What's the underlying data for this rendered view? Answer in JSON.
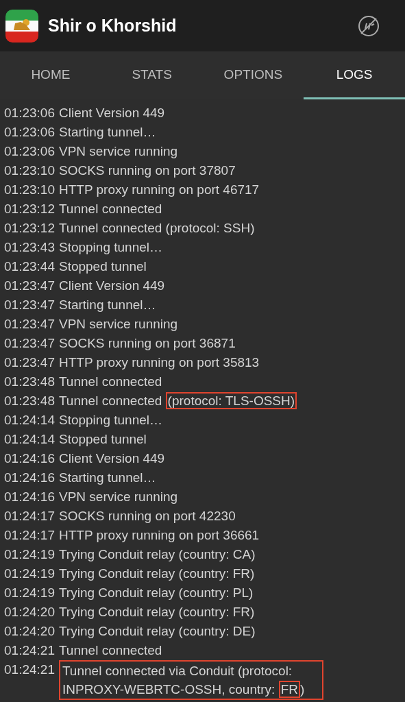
{
  "app_bar": {
    "title": "Shir o Khorshid"
  },
  "tabs": [
    {
      "label": "HOME",
      "selected": false
    },
    {
      "label": "STATS",
      "selected": false
    },
    {
      "label": "OPTIONS",
      "selected": false
    },
    {
      "label": "LOGS",
      "selected": true
    }
  ],
  "logs": [
    {
      "time": "01:23:06",
      "boxed": false,
      "message": [
        {
          "text": "Client Version 449",
          "boxed": false
        }
      ]
    },
    {
      "time": "01:23:06",
      "boxed": false,
      "message": [
        {
          "text": "Starting tunnel…",
          "boxed": false
        }
      ]
    },
    {
      "time": "01:23:06",
      "boxed": false,
      "message": [
        {
          "text": "VPN service running",
          "boxed": false
        }
      ]
    },
    {
      "time": "01:23:10",
      "boxed": false,
      "message": [
        {
          "text": "SOCKS running on port 37807",
          "boxed": false
        }
      ]
    },
    {
      "time": "01:23:10",
      "boxed": false,
      "message": [
        {
          "text": "HTTP proxy running on port 46717",
          "boxed": false
        }
      ]
    },
    {
      "time": "01:23:12",
      "boxed": false,
      "message": [
        {
          "text": "Tunnel connected",
          "boxed": false
        }
      ]
    },
    {
      "time": "01:23:12",
      "boxed": false,
      "message": [
        {
          "text": "Tunnel connected (protocol: SSH)",
          "boxed": false
        }
      ]
    },
    {
      "time": "01:23:43",
      "boxed": false,
      "message": [
        {
          "text": "Stopping tunnel…",
          "boxed": false
        }
      ]
    },
    {
      "time": "01:23:44",
      "boxed": false,
      "message": [
        {
          "text": "Stopped tunnel",
          "boxed": false
        }
      ]
    },
    {
      "time": "01:23:47",
      "boxed": false,
      "message": [
        {
          "text": "Client Version 449",
          "boxed": false
        }
      ]
    },
    {
      "time": "01:23:47",
      "boxed": false,
      "message": [
        {
          "text": "Starting tunnel…",
          "boxed": false
        }
      ]
    },
    {
      "time": "01:23:47",
      "boxed": false,
      "message": [
        {
          "text": "VPN service running",
          "boxed": false
        }
      ]
    },
    {
      "time": "01:23:47",
      "boxed": false,
      "message": [
        {
          "text": "SOCKS running on port 36871",
          "boxed": false
        }
      ]
    },
    {
      "time": "01:23:47",
      "boxed": false,
      "message": [
        {
          "text": "HTTP proxy running on port 35813",
          "boxed": false
        }
      ]
    },
    {
      "time": "01:23:48",
      "boxed": false,
      "message": [
        {
          "text": "Tunnel connected",
          "boxed": false
        }
      ]
    },
    {
      "time": "01:23:48",
      "boxed": false,
      "message": [
        {
          "text": "Tunnel connected ",
          "boxed": false
        },
        {
          "text": "(protocol: TLS-OSSH)",
          "boxed": true
        }
      ]
    },
    {
      "time": "01:24:14",
      "boxed": false,
      "message": [
        {
          "text": "Stopping tunnel…",
          "boxed": false
        }
      ]
    },
    {
      "time": "01:24:14",
      "boxed": false,
      "message": [
        {
          "text": "Stopped tunnel",
          "boxed": false
        }
      ]
    },
    {
      "time": "01:24:16",
      "boxed": false,
      "message": [
        {
          "text": "Client Version 449",
          "boxed": false
        }
      ]
    },
    {
      "time": "01:24:16",
      "boxed": false,
      "message": [
        {
          "text": "Starting tunnel…",
          "boxed": false
        }
      ]
    },
    {
      "time": "01:24:16",
      "boxed": false,
      "message": [
        {
          "text": "VPN service running",
          "boxed": false
        }
      ]
    },
    {
      "time": "01:24:17",
      "boxed": false,
      "message": [
        {
          "text": "SOCKS running on port 42230",
          "boxed": false
        }
      ]
    },
    {
      "time": "01:24:17",
      "boxed": false,
      "message": [
        {
          "text": "HTTP proxy running on port 36661",
          "boxed": false
        }
      ]
    },
    {
      "time": "01:24:19",
      "boxed": false,
      "message": [
        {
          "text": "Trying Conduit relay (country: CA)",
          "boxed": false
        }
      ]
    },
    {
      "time": "01:24:19",
      "boxed": false,
      "message": [
        {
          "text": "Trying Conduit relay (country: FR)",
          "boxed": false
        }
      ]
    },
    {
      "time": "01:24:19",
      "boxed": false,
      "message": [
        {
          "text": "Trying Conduit relay (country: PL)",
          "boxed": false
        }
      ]
    },
    {
      "time": "01:24:20",
      "boxed": false,
      "message": [
        {
          "text": "Trying Conduit relay (country: FR)",
          "boxed": false
        }
      ]
    },
    {
      "time": "01:24:20",
      "boxed": false,
      "message": [
        {
          "text": "Trying Conduit relay (country: DE)",
          "boxed": false
        }
      ]
    },
    {
      "time": "01:24:21",
      "boxed": false,
      "message": [
        {
          "text": "Tunnel connected",
          "boxed": false
        }
      ]
    },
    {
      "time": "01:24:21",
      "boxed": true,
      "message": [
        {
          "text": "Tunnel connected via Conduit (protocol: INPROXY-WEBRTC-OSSH, country: ",
          "boxed": false
        },
        {
          "text": "FR",
          "boxed": true
        },
        {
          "text": ")",
          "boxed": false
        }
      ]
    }
  ]
}
